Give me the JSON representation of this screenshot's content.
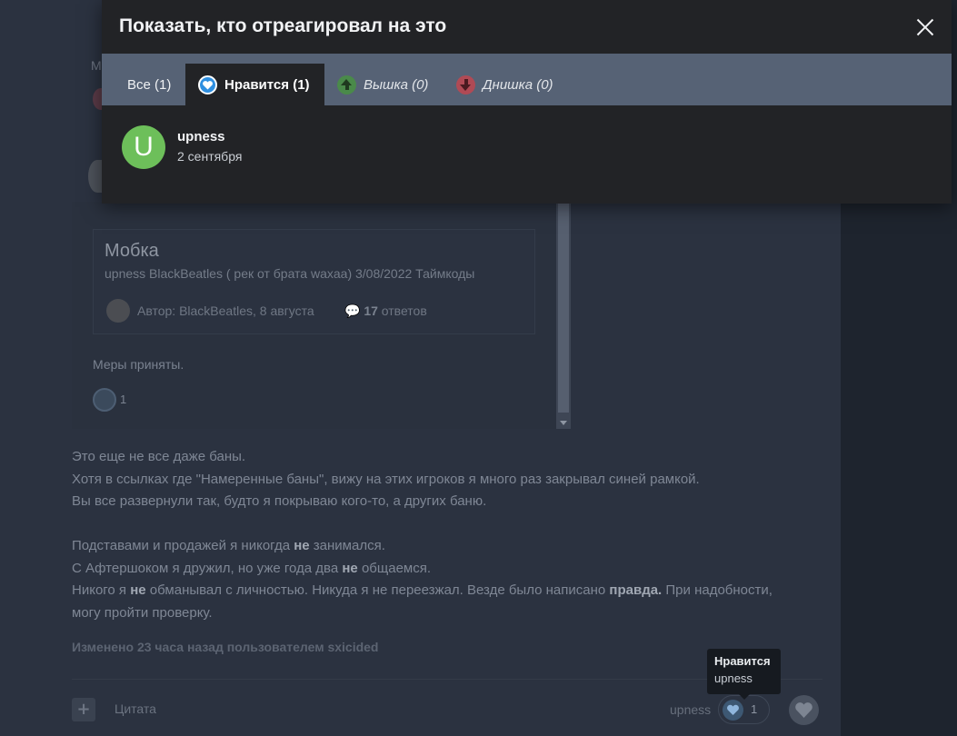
{
  "modal": {
    "title": "Показать, кто отреагировал на это",
    "tabs": [
      {
        "label": "Все",
        "count": "(1)"
      },
      {
        "label": "Нравится",
        "count": "(1)"
      },
      {
        "label": "Вышка",
        "count": "(0)"
      },
      {
        "label": "Днишка",
        "count": "(0)"
      }
    ],
    "users": [
      {
        "initial": "U",
        "name": "upness",
        "date": "2 сентября",
        "avatar_color": "#6dbf5a"
      }
    ]
  },
  "background": {
    "side_letter": "М",
    "topic": {
      "title": "Мобка",
      "subtitle": "upness BlackBeatles ( рек от брата waxaa) 3/08/2022  Таймкоды",
      "author": "Автор: BlackBeatles, 8 августа",
      "replies_count": "17",
      "replies_label": " ответов"
    },
    "quote_text": "Меры приняты.",
    "quote_reaction_count": "1",
    "post": {
      "line1": "Это еще не все даже баны.",
      "line2": "Хотя в ссылках где \"Намеренные баны\", вижу на этих игроков я много раз закрывал синей рамкой.",
      "line3": "Вы все развернули так, будто я покрываю кого-то, а других баню.",
      "line4a": "Подставами и продажей я никогда ",
      "line4b": "не",
      "line4c": " занимался.",
      "line5a": "С Афтершоком я дружил, но уже года два ",
      "line5b": "не",
      "line5c": " общаемся.",
      "line6a": "Никого я ",
      "line6b": "не",
      "line6c": " обманывал с личностью. Никуда я не переезжал. Везде было написано ",
      "line6d": "правда.",
      "line6e": " При надобности,",
      "line7": "могу пройти проверку."
    },
    "edited": "Изменено 23 часа назад пользователем sxicided",
    "footer": {
      "plus": "+",
      "quote": "Цитата",
      "reactor": "upness",
      "reaction_count": "1"
    },
    "tooltip": {
      "title": "Нравится",
      "user": "upness"
    }
  },
  "colors": {
    "like": "#2f8fe0",
    "up": "#4a8a4a",
    "down": "#b04a55",
    "tabs_bar": "#566275",
    "modal_bg": "#222326"
  }
}
